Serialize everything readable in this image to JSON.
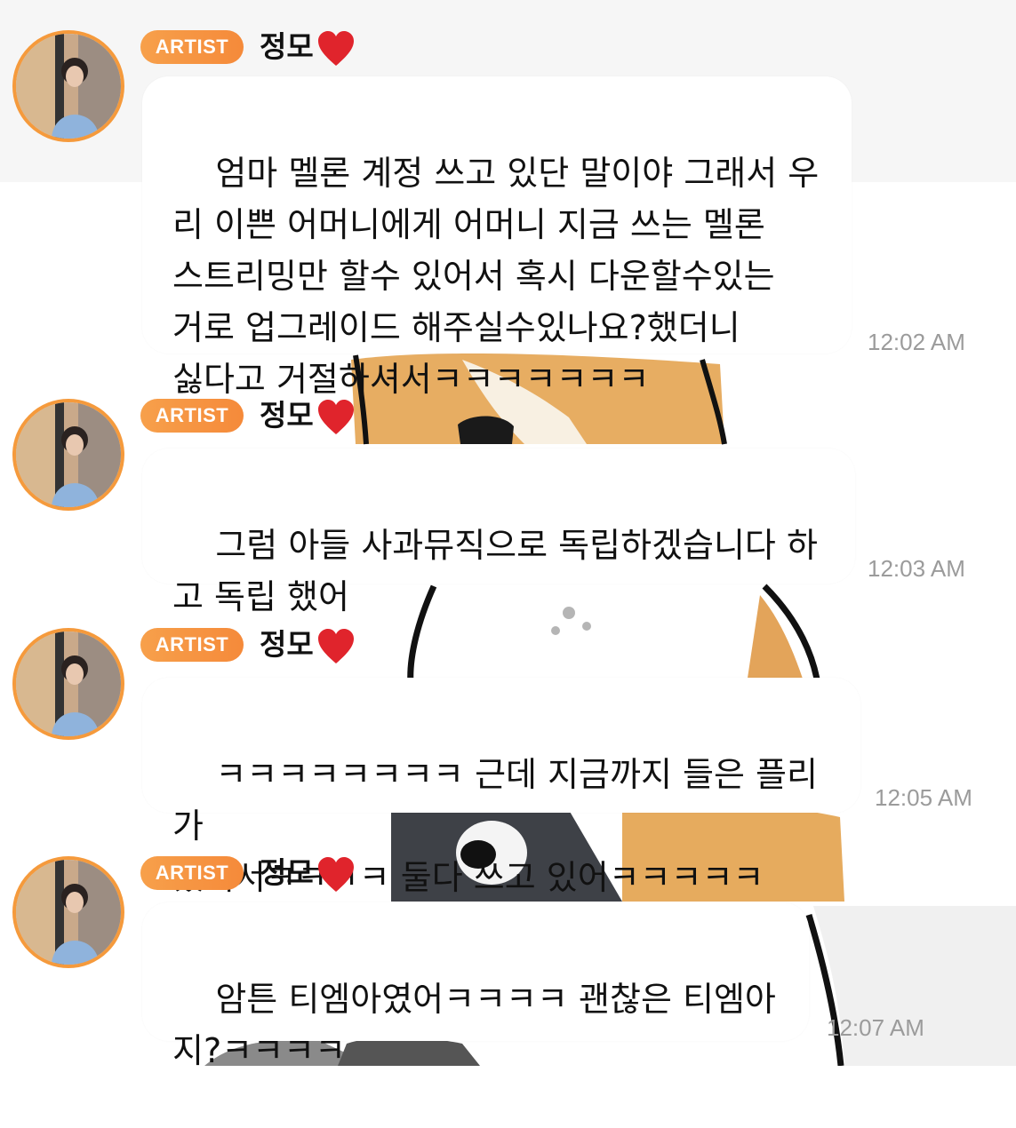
{
  "chat": {
    "messages": [
      {
        "badge": "ARTIST",
        "name": "정모",
        "text": "엄마 멜론 계정 쓰고 있단 말이야 그래서 우\n리 이쁜 어머니에게 어머니 지금 쓰는 멜론\n스트리밍만 할수 있어서 혹시 다운할수있는\n거로 업그레이드 해주실수있나요?했더니\n싫다고 거절하셔서ㅋㅋㅋㅋㅋㅋㅋ",
        "time": "12:02 AM"
      },
      {
        "badge": "ARTIST",
        "name": "정모",
        "text": "그럼 아들 사과뮤직으로 독립하겠습니다 하\n고 독립 했어",
        "time": "12:03 AM"
      },
      {
        "badge": "ARTIST",
        "name": "정모",
        "text": "ㅋㅋㅋㅋㅋㅋㅋㅋ 근데 지금까지 들은 플리가\n있어서ㅋㅋㅋㅋ 둘다 쓰고 있어ㅋㅋㅋㅋㅋ",
        "time": "12:05 AM"
      },
      {
        "badge": "ARTIST",
        "name": "정모",
        "text": "암튼 티엠아였어ㅋㅋㅋㅋ 괜찮은 티엠아\n지?ㅋㅋㅋㅋ",
        "time": "12:07 AM"
      }
    ]
  },
  "colors": {
    "badge": "#f5943f",
    "avatar_ring": "#f59a3c",
    "timestamp": "#9b9b9b",
    "heart": "#e0242c"
  },
  "icons": {
    "heart": "heart-emoji-icon",
    "avatar": "profile-photo"
  }
}
